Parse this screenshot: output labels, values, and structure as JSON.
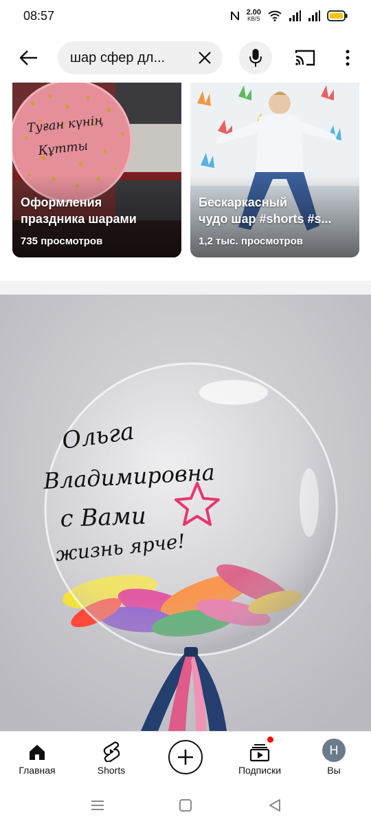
{
  "status_bar": {
    "time": "08:57",
    "net_speed_value": "2.00",
    "net_speed_unit": "KB/S",
    "battery_color": "#f4c400"
  },
  "search": {
    "query": "шар сфер дл...",
    "icons": [
      "back-arrow-icon",
      "close-icon",
      "microphone-icon",
      "cast-icon",
      "more-vert-icon"
    ]
  },
  "shorts": [
    {
      "title_line1": "Оформления",
      "title_line2": "праздника шарами",
      "views": "735 просмотров",
      "thumb_text": [
        "Туған күнің",
        "Құтты"
      ]
    },
    {
      "title_line1": "Бескаркасный",
      "title_line2": "чудо шар #shorts #s...",
      "views": "1,2 тыс. просмотров"
    }
  ],
  "video_thumbnail": {
    "lettering": [
      "Ольга",
      "Владимировна",
      "с Вами",
      "жизнь ярче!"
    ]
  },
  "bottom_nav": {
    "items": [
      {
        "label": "Главная",
        "icon": "home-icon"
      },
      {
        "label": "Shorts",
        "icon": "shorts-icon"
      },
      {
        "label": "",
        "icon": "create-plus-icon"
      },
      {
        "label": "Подписки",
        "icon": "subscriptions-icon"
      },
      {
        "label": "Вы",
        "icon": "avatar"
      }
    ],
    "avatar_letter": "Н",
    "notification_color": "#ff0000"
  },
  "system_nav": {
    "icons": [
      "recents-menu-icon",
      "home-square-icon",
      "back-triangle-icon"
    ]
  }
}
